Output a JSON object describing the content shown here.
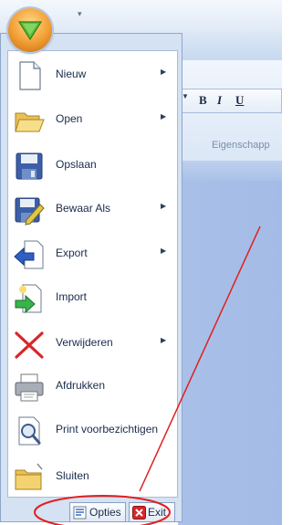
{
  "menu": {
    "items": [
      {
        "label": "Nieuw",
        "icon": "new-document-icon",
        "has_submenu": true
      },
      {
        "label": "Open",
        "icon": "folder-open-icon",
        "has_submenu": true
      },
      {
        "label": "Opslaan",
        "icon": "save-disk-icon",
        "has_submenu": false
      },
      {
        "label": "Bewaar Als",
        "icon": "save-as-icon",
        "has_submenu": true
      },
      {
        "label": "Export",
        "icon": "export-icon",
        "has_submenu": true
      },
      {
        "label": "Import",
        "icon": "import-icon",
        "has_submenu": false
      },
      {
        "label": "Verwijderen",
        "icon": "delete-x-icon",
        "has_submenu": true
      },
      {
        "label": "Afdrukken",
        "icon": "printer-icon",
        "has_submenu": false
      },
      {
        "label": "Print voorbezichtigen",
        "icon": "print-preview-icon",
        "has_submenu": false
      },
      {
        "label": "Sluiten",
        "icon": "close-folder-icon",
        "has_submenu": false
      }
    ],
    "options_label": "Opties",
    "exit_label": "Exit"
  },
  "ribbon": {
    "qat_arrow": "▾",
    "format_buttons": [
      "B",
      "I",
      "U"
    ],
    "group_label": "Eigenschapp"
  },
  "colors": {
    "menu_bg": "#d5e2f3",
    "annotation": "#e02020",
    "app_button": "#f3a238",
    "app_arrow": "#5cc03c"
  }
}
